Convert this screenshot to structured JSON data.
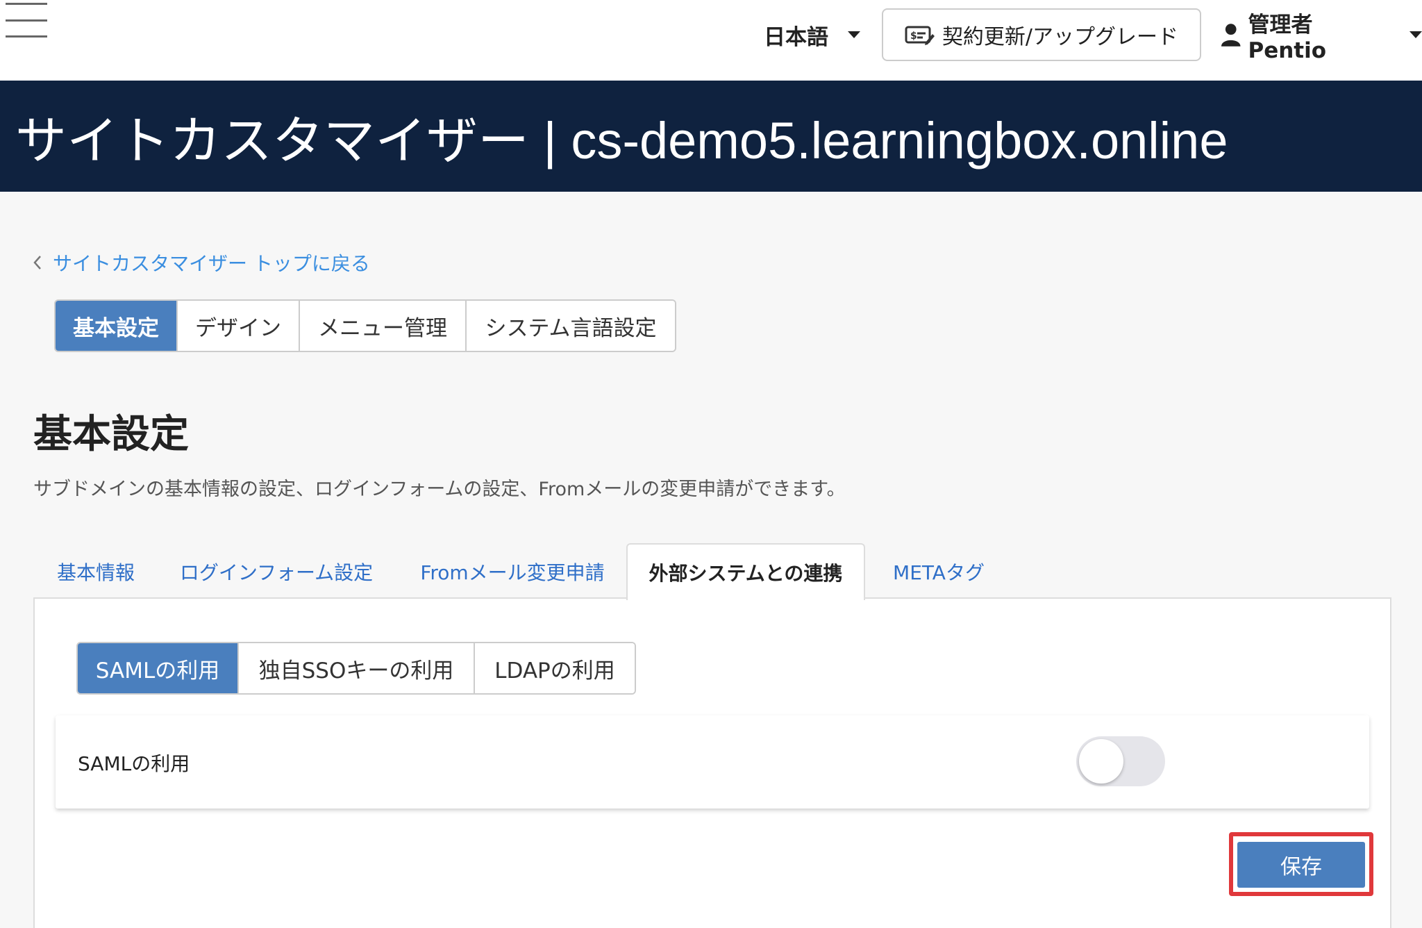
{
  "topbar": {
    "language": "日本語",
    "upgrade_label": "契約更新/アップグレード",
    "user_label": "管理者 Pentio"
  },
  "header": {
    "title": "サイトカスタマイザー | cs-demo5.learningbox.online"
  },
  "back_link": "サイトカスタマイザー トップに戻る",
  "main_tabs": [
    {
      "label": "基本設定",
      "active": true
    },
    {
      "label": "デザイン",
      "active": false
    },
    {
      "label": "メニュー管理",
      "active": false
    },
    {
      "label": "システム言語設定",
      "active": false
    }
  ],
  "section": {
    "title": "基本設定",
    "description": "サブドメインの基本情報の設定、ログインフォームの設定、Fromメールの変更申請ができます。"
  },
  "tabs": [
    {
      "label": "基本情報",
      "active": false
    },
    {
      "label": "ログインフォーム設定",
      "active": false
    },
    {
      "label": "Fromメール変更申請",
      "active": false
    },
    {
      "label": "外部システムとの連携",
      "active": true
    },
    {
      "label": "METAタグ",
      "active": false
    }
  ],
  "sub_tabs": [
    {
      "label": "SAMLの利用",
      "active": true
    },
    {
      "label": "独自SSOキーの利用",
      "active": false
    },
    {
      "label": "LDAPの利用",
      "active": false
    }
  ],
  "saml_setting": {
    "label": "SAMLの利用",
    "enabled": false
  },
  "save_label": "保存",
  "colors": {
    "header_bg": "#0f223f",
    "accent": "#4a7fbe",
    "link": "#3a8ee0",
    "highlight": "#e0383b"
  }
}
